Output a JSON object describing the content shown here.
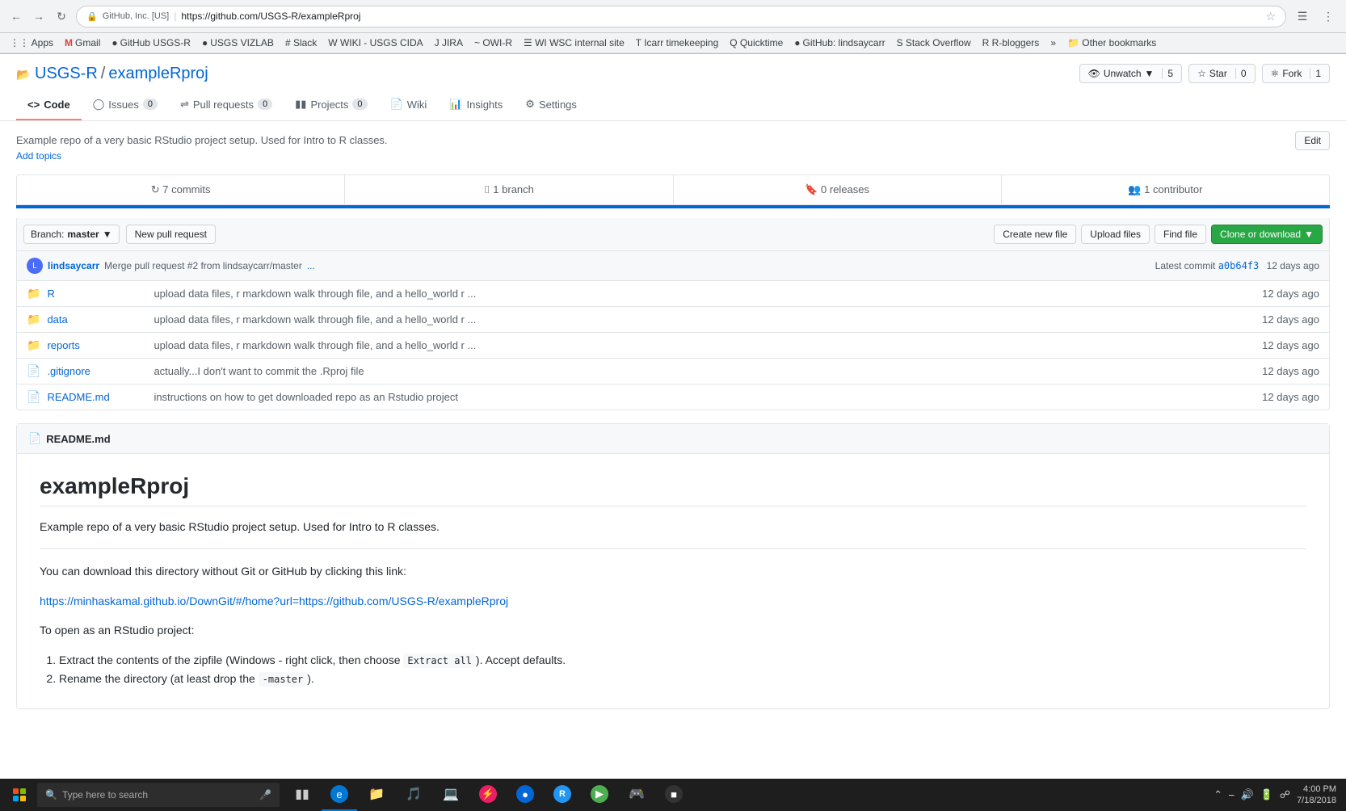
{
  "browser": {
    "url": "https://github.com/USGS-R/exampleRproj",
    "url_display": "https://github.com/USGS-R/exampleRproj",
    "secure_label": "GitHub, Inc. [US]",
    "back_btn": "←",
    "forward_btn": "→",
    "refresh_btn": "↻"
  },
  "bookmarks": [
    {
      "label": "Apps",
      "icon": "⋮⋮"
    },
    {
      "label": "Gmail",
      "icon": "M"
    },
    {
      "label": "GitHub USGS-R",
      "icon": "⬤"
    },
    {
      "label": "USGS VIZLAB",
      "icon": "⬤"
    },
    {
      "label": "Slack",
      "icon": "#"
    },
    {
      "label": "WIKI - USGS CIDA",
      "icon": "W"
    },
    {
      "label": "JIRA",
      "icon": "J"
    },
    {
      "label": "OWI-R",
      "icon": "~"
    },
    {
      "label": "WI WSC internal site",
      "icon": "☰"
    },
    {
      "label": "Icarr timekeeping",
      "icon": "T"
    },
    {
      "label": "Quicktime",
      "icon": "Q"
    },
    {
      "label": "GitHub: lindsaycarr",
      "icon": "⬤"
    },
    {
      "label": "Stack Overflow",
      "icon": "S"
    },
    {
      "label": "R-bloggers",
      "icon": "R"
    },
    {
      "label": "»",
      "icon": ""
    },
    {
      "label": "Other bookmarks",
      "icon": "📁"
    }
  ],
  "repo": {
    "org": "USGS-R",
    "name": "exampleRproj",
    "description": "Example repo of a very basic RStudio project setup. Used for Intro to R classes.",
    "add_topics": "Add topics",
    "edit_btn": "Edit",
    "actions": {
      "unwatch_label": "Unwatch",
      "unwatch_count": "5",
      "star_label": "Star",
      "star_count": "0",
      "fork_label": "Fork",
      "fork_count": "1"
    }
  },
  "tabs": [
    {
      "label": "Code",
      "icon": "◁▷",
      "count": null,
      "active": true
    },
    {
      "label": "Issues",
      "icon": "●",
      "count": "0",
      "active": false
    },
    {
      "label": "Pull requests",
      "icon": "⎇",
      "count": "0",
      "active": false
    },
    {
      "label": "Projects",
      "icon": "☰",
      "count": "0",
      "active": false
    },
    {
      "label": "Wiki",
      "icon": "📄",
      "count": null,
      "active": false
    },
    {
      "label": "Insights",
      "icon": "📈",
      "count": null,
      "active": false
    },
    {
      "label": "Settings",
      "icon": "⚙",
      "count": null,
      "active": false
    }
  ],
  "stats": {
    "commits": "7 commits",
    "branch": "1 branch",
    "releases": "0 releases",
    "contributors": "1 contributor"
  },
  "toolbar": {
    "branch_label": "Branch:",
    "branch_name": "master",
    "new_pr": "New pull request",
    "create_file": "Create new file",
    "upload_files": "Upload files",
    "find_file": "Find file",
    "clone": "Clone or download"
  },
  "commit": {
    "avatar_text": "L",
    "author": "lindsaycarr",
    "message": "Merge pull request #2 from lindsaycarr/master",
    "ellipsis": "...",
    "hash_label": "Latest commit",
    "hash": "a0b64f3",
    "time": "12 days ago"
  },
  "files": [
    {
      "type": "dir",
      "name": "R",
      "message": "upload data files, r markdown walk through file, and a hello_world r ...",
      "time": "12 days ago"
    },
    {
      "type": "dir",
      "name": "data",
      "message": "upload data files, r markdown walk through file, and a hello_world r ...",
      "time": "12 days ago"
    },
    {
      "type": "dir",
      "name": "reports",
      "message": "upload data files, r markdown walk through file, and a hello_world r ...",
      "time": "12 days ago"
    },
    {
      "type": "file",
      "name": ".gitignore",
      "message": "actually...I don't want to commit the .Rproj file",
      "time": "12 days ago"
    },
    {
      "type": "file",
      "name": "README.md",
      "message": "instructions on how to get downloaded repo as an Rstudio project",
      "time": "12 days ago"
    }
  ],
  "readme": {
    "title": "exampleRproj",
    "description": "Example repo of a very basic RStudio project setup. Used for Intro to R classes.",
    "download_intro": "You can download this directory without Git or GitHub by clicking this link:",
    "download_link": "https://minhaskamal.github.io/DownGit/#/home?url=https://github.com/USGS-R/exampleRproj",
    "open_rstudio": "To open as an RStudio project:",
    "steps": [
      {
        "text": "Extract the contents of the zipfile (Windows - right click, then choose ",
        "code": "Extract all",
        "text2": "). Accept defaults."
      },
      {
        "text": "Rename the directory (at least drop the ",
        "code": "-master",
        "text2": ")."
      }
    ]
  },
  "taskbar": {
    "search_placeholder": "Type here to search",
    "time": "4:00 PM",
    "date": "7/18/2018",
    "apps": [
      {
        "icon": "⊞",
        "label": "Start",
        "color": "#0078d4"
      },
      {
        "icon": "⊕",
        "label": "Task View",
        "color": "#555"
      },
      {
        "icon": "🌐",
        "label": "Edge",
        "color": "#0078d4"
      },
      {
        "icon": "📁",
        "label": "File Explorer",
        "color": "#f9a825"
      },
      {
        "icon": "🎵",
        "label": "Music",
        "color": "#e91e63"
      },
      {
        "icon": "💻",
        "label": "App6",
        "color": "#555"
      },
      {
        "icon": "⚡",
        "label": "App7",
        "color": "#e91e63"
      },
      {
        "icon": "🌀",
        "label": "App8",
        "color": "#0366d6"
      },
      {
        "icon": "R",
        "label": "R",
        "color": "#2196f3"
      },
      {
        "icon": "▶",
        "label": "App10",
        "color": "#4caf50"
      },
      {
        "icon": "♦",
        "label": "App11",
        "color": "#555"
      },
      {
        "icon": "⬛",
        "label": "App12",
        "color": "#333"
      }
    ]
  }
}
